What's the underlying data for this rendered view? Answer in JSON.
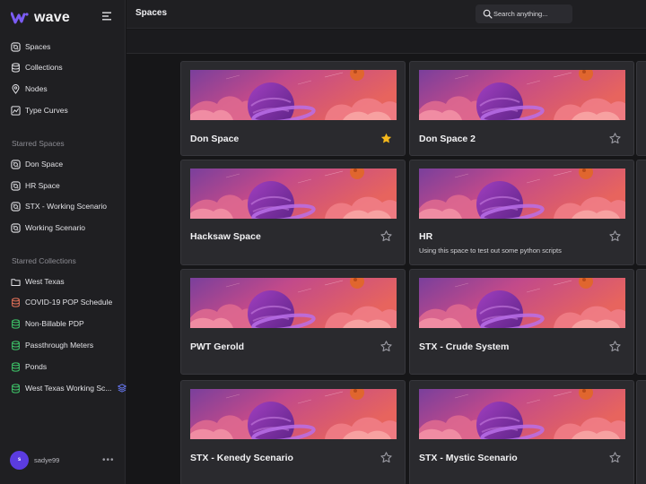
{
  "app": {
    "name": "wave"
  },
  "sidebar": {
    "main_nav": [
      {
        "label": "Spaces",
        "icon": "spaces-icon"
      },
      {
        "label": "Collections",
        "icon": "database-icon"
      },
      {
        "label": "Nodes",
        "icon": "pin-icon"
      },
      {
        "label": "Type Curves",
        "icon": "curve-icon"
      }
    ],
    "starred_spaces_label": "Starred Spaces",
    "starred_spaces": [
      {
        "label": "Don Space",
        "icon": "spaces-icon"
      },
      {
        "label": "HR Space",
        "icon": "spaces-icon"
      },
      {
        "label": "STX - Working Scenario",
        "icon": "spaces-icon"
      },
      {
        "label": "Working Scenario",
        "icon": "spaces-icon"
      }
    ],
    "starred_collections_label": "Starred Collections",
    "starred_collections": [
      {
        "label": "West Texas",
        "icon": "folder-icon",
        "color": "#e2e2e6"
      },
      {
        "label": "COVID-19 POP Schedule",
        "icon": "database-icon",
        "color": "#e8735a"
      },
      {
        "label": "Non-Billable PDP",
        "icon": "database-icon",
        "color": "#3fc96b"
      },
      {
        "label": "Passthrough Meters",
        "icon": "database-icon",
        "color": "#3fc96b"
      },
      {
        "label": "Ponds",
        "icon": "database-icon",
        "color": "#3fc96b"
      },
      {
        "label": "West Texas Working Sc...",
        "icon": "database-icon",
        "color": "#3fc96b"
      }
    ],
    "user": {
      "initial": "s",
      "name": "sadye99"
    },
    "more_label": "•••"
  },
  "header": {
    "title": "Spaces",
    "search_placeholder": "Search anything..."
  },
  "cards": [
    {
      "name": "Don Space",
      "description": "",
      "starred": true
    },
    {
      "name": "Don Space 2",
      "description": "",
      "starred": false
    },
    {
      "name": "Hacksaw Space",
      "description": "",
      "starred": false
    },
    {
      "name": "HR",
      "description": "Using this space to test out some python scripts",
      "starred": false
    },
    {
      "name": "PWT Gerold",
      "description": "",
      "starred": false
    },
    {
      "name": "STX - Crude System",
      "description": "",
      "starred": false
    },
    {
      "name": "STX - Kenedy Scenario",
      "description": "",
      "starred": false
    },
    {
      "name": "STX - Mystic Scenario",
      "description": "",
      "starred": false
    }
  ],
  "colors": {
    "accent": "#5b3ce0",
    "star_active": "#f5b81c",
    "star_inactive": "#9a9aa2"
  }
}
